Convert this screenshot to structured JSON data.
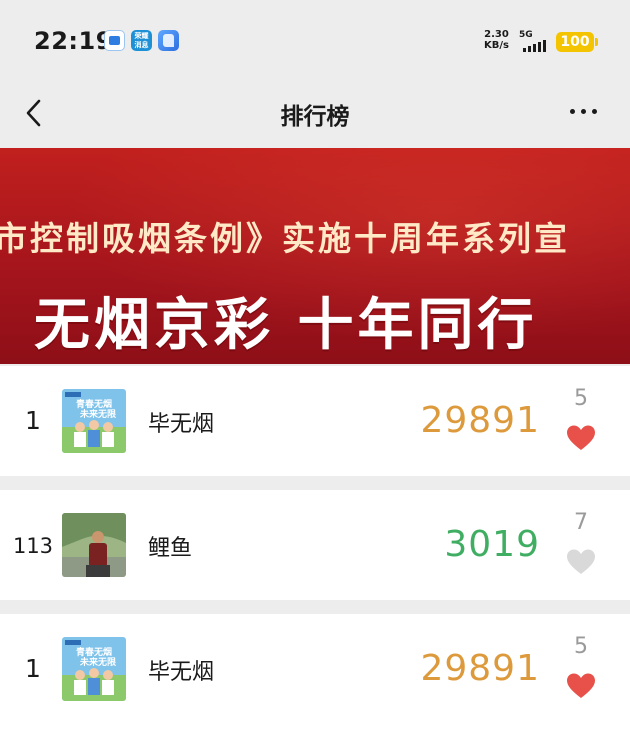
{
  "status_bar": {
    "time": "22:19",
    "net_speed_value": "2.30",
    "net_speed_unit": "KB/s",
    "network": "5G",
    "battery": "100",
    "app_icon_2_text": "荣耀\n消息"
  },
  "nav": {
    "title": "排行榜"
  },
  "banner": {
    "line1": "市控制吸烟条例》实施十周年系列宣",
    "slogan": "无烟京彩 十年同行"
  },
  "rows": [
    {
      "rank": "1",
      "name": "毕无烟",
      "steps": "29891",
      "likes": "5",
      "liked": true,
      "steps_color": "#dd9a3c",
      "avatar_text": "青春无烟 未来无限"
    },
    {
      "rank": "113",
      "name": "鲤鱼",
      "steps": "3019",
      "likes": "7",
      "liked": false,
      "steps_color": "#3fae62"
    },
    {
      "rank": "1",
      "name": "毕无烟",
      "steps": "29891",
      "likes": "5",
      "liked": true,
      "steps_color": "#dd9a3c",
      "avatar_text": "青春无烟 未来无限"
    }
  ],
  "colors": {
    "heart_liked": "#e8504a",
    "heart_unliked": "#d9d9d9",
    "battery": "#f5c400",
    "banner_red": "#b01a1c"
  }
}
